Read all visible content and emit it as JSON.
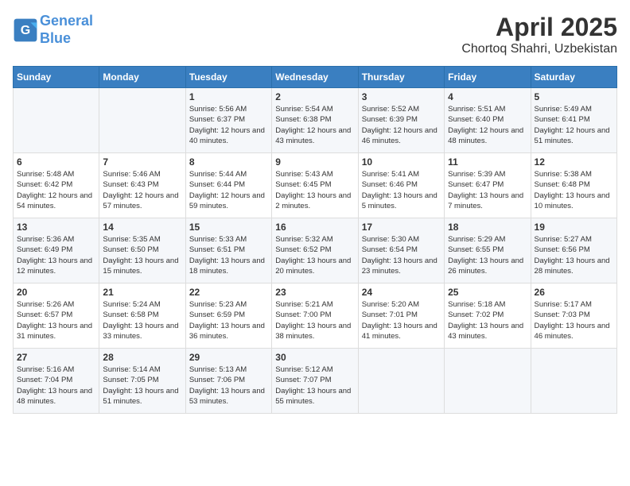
{
  "header": {
    "logo_line1": "General",
    "logo_line2": "Blue",
    "month": "April 2025",
    "location": "Chortoq Shahri, Uzbekistan"
  },
  "weekdays": [
    "Sunday",
    "Monday",
    "Tuesday",
    "Wednesday",
    "Thursday",
    "Friday",
    "Saturday"
  ],
  "weeks": [
    [
      {
        "day": "",
        "info": ""
      },
      {
        "day": "",
        "info": ""
      },
      {
        "day": "1",
        "info": "Sunrise: 5:56 AM\nSunset: 6:37 PM\nDaylight: 12 hours and 40 minutes."
      },
      {
        "day": "2",
        "info": "Sunrise: 5:54 AM\nSunset: 6:38 PM\nDaylight: 12 hours and 43 minutes."
      },
      {
        "day": "3",
        "info": "Sunrise: 5:52 AM\nSunset: 6:39 PM\nDaylight: 12 hours and 46 minutes."
      },
      {
        "day": "4",
        "info": "Sunrise: 5:51 AM\nSunset: 6:40 PM\nDaylight: 12 hours and 48 minutes."
      },
      {
        "day": "5",
        "info": "Sunrise: 5:49 AM\nSunset: 6:41 PM\nDaylight: 12 hours and 51 minutes."
      }
    ],
    [
      {
        "day": "6",
        "info": "Sunrise: 5:48 AM\nSunset: 6:42 PM\nDaylight: 12 hours and 54 minutes."
      },
      {
        "day": "7",
        "info": "Sunrise: 5:46 AM\nSunset: 6:43 PM\nDaylight: 12 hours and 57 minutes."
      },
      {
        "day": "8",
        "info": "Sunrise: 5:44 AM\nSunset: 6:44 PM\nDaylight: 12 hours and 59 minutes."
      },
      {
        "day": "9",
        "info": "Sunrise: 5:43 AM\nSunset: 6:45 PM\nDaylight: 13 hours and 2 minutes."
      },
      {
        "day": "10",
        "info": "Sunrise: 5:41 AM\nSunset: 6:46 PM\nDaylight: 13 hours and 5 minutes."
      },
      {
        "day": "11",
        "info": "Sunrise: 5:39 AM\nSunset: 6:47 PM\nDaylight: 13 hours and 7 minutes."
      },
      {
        "day": "12",
        "info": "Sunrise: 5:38 AM\nSunset: 6:48 PM\nDaylight: 13 hours and 10 minutes."
      }
    ],
    [
      {
        "day": "13",
        "info": "Sunrise: 5:36 AM\nSunset: 6:49 PM\nDaylight: 13 hours and 12 minutes."
      },
      {
        "day": "14",
        "info": "Sunrise: 5:35 AM\nSunset: 6:50 PM\nDaylight: 13 hours and 15 minutes."
      },
      {
        "day": "15",
        "info": "Sunrise: 5:33 AM\nSunset: 6:51 PM\nDaylight: 13 hours and 18 minutes."
      },
      {
        "day": "16",
        "info": "Sunrise: 5:32 AM\nSunset: 6:52 PM\nDaylight: 13 hours and 20 minutes."
      },
      {
        "day": "17",
        "info": "Sunrise: 5:30 AM\nSunset: 6:54 PM\nDaylight: 13 hours and 23 minutes."
      },
      {
        "day": "18",
        "info": "Sunrise: 5:29 AM\nSunset: 6:55 PM\nDaylight: 13 hours and 26 minutes."
      },
      {
        "day": "19",
        "info": "Sunrise: 5:27 AM\nSunset: 6:56 PM\nDaylight: 13 hours and 28 minutes."
      }
    ],
    [
      {
        "day": "20",
        "info": "Sunrise: 5:26 AM\nSunset: 6:57 PM\nDaylight: 13 hours and 31 minutes."
      },
      {
        "day": "21",
        "info": "Sunrise: 5:24 AM\nSunset: 6:58 PM\nDaylight: 13 hours and 33 minutes."
      },
      {
        "day": "22",
        "info": "Sunrise: 5:23 AM\nSunset: 6:59 PM\nDaylight: 13 hours and 36 minutes."
      },
      {
        "day": "23",
        "info": "Sunrise: 5:21 AM\nSunset: 7:00 PM\nDaylight: 13 hours and 38 minutes."
      },
      {
        "day": "24",
        "info": "Sunrise: 5:20 AM\nSunset: 7:01 PM\nDaylight: 13 hours and 41 minutes."
      },
      {
        "day": "25",
        "info": "Sunrise: 5:18 AM\nSunset: 7:02 PM\nDaylight: 13 hours and 43 minutes."
      },
      {
        "day": "26",
        "info": "Sunrise: 5:17 AM\nSunset: 7:03 PM\nDaylight: 13 hours and 46 minutes."
      }
    ],
    [
      {
        "day": "27",
        "info": "Sunrise: 5:16 AM\nSunset: 7:04 PM\nDaylight: 13 hours and 48 minutes."
      },
      {
        "day": "28",
        "info": "Sunrise: 5:14 AM\nSunset: 7:05 PM\nDaylight: 13 hours and 51 minutes."
      },
      {
        "day": "29",
        "info": "Sunrise: 5:13 AM\nSunset: 7:06 PM\nDaylight: 13 hours and 53 minutes."
      },
      {
        "day": "30",
        "info": "Sunrise: 5:12 AM\nSunset: 7:07 PM\nDaylight: 13 hours and 55 minutes."
      },
      {
        "day": "",
        "info": ""
      },
      {
        "day": "",
        "info": ""
      },
      {
        "day": "",
        "info": ""
      }
    ]
  ]
}
